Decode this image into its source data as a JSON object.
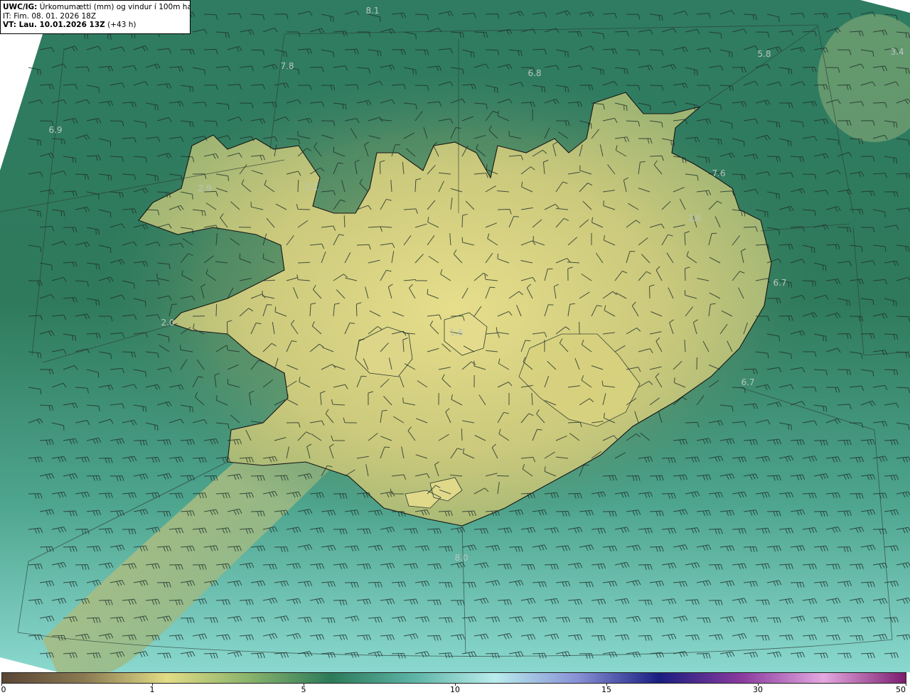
{
  "header": {
    "model": "UWC/IG:",
    "title": "Úrkomumætti (mm) og vindur í 100m hæð",
    "it_line": "IT: Fim. 08. 01. 2026 18Z",
    "vt_bold": "VT: Lau. 10.01.2026 13Z",
    "vt_offset": "(+43 h)"
  },
  "map_values": [
    {
      "label": "8.1"
    },
    {
      "label": "5.8"
    },
    {
      "label": "3.4"
    },
    {
      "label": "7.8"
    },
    {
      "label": "6.8"
    },
    {
      "label": "6.9"
    },
    {
      "label": "2.9"
    },
    {
      "label": "2.2"
    },
    {
      "label": "7.6"
    },
    {
      "label": "2.6"
    },
    {
      "label": "6.7"
    },
    {
      "label": "2.0"
    },
    {
      "label": "1.6"
    },
    {
      "label": "6.7"
    },
    {
      "label": "8.0"
    }
  ],
  "colorbar": {
    "ticks": [
      "0",
      "1",
      "5",
      "10",
      "15",
      "30",
      "50"
    ],
    "colors": [
      "#5a4535",
      "#8a7a52",
      "#e2dc85",
      "#8ab36b",
      "#2c7a5a",
      "#5cb3a5",
      "#b9ecec",
      "#8892d6",
      "#1a1d80",
      "#8a3a9e",
      "#e4a8df",
      "#7c1d6f"
    ]
  },
  "legend_colors": {
    "land_high": "#e4dc86",
    "land_mid": "#b8c27a",
    "sea_dark": "#2f7a5c",
    "sea_light": "#7fcfc2",
    "coast": "#1a1a1a",
    "barb": "#1f2f2a"
  }
}
